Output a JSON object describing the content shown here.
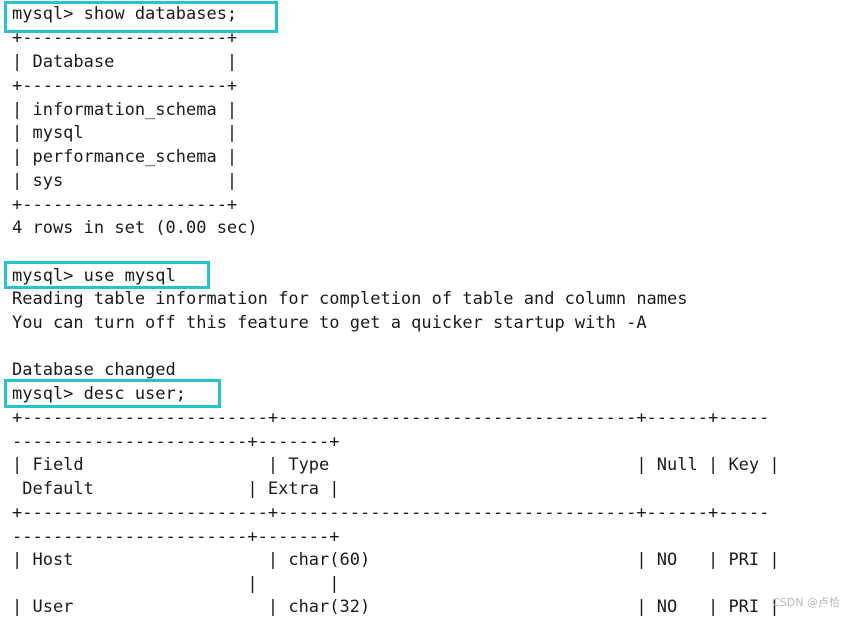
{
  "terminal": {
    "lines": [
      "mysql> show databases;",
      "+--------------------+",
      "| Database           |",
      "+--------------------+",
      "| information_schema |",
      "| mysql              |",
      "| performance_schema |",
      "| sys                |",
      "+--------------------+",
      "4 rows in set (0.00 sec)",
      "",
      "mysql> use mysql",
      "Reading table information for completion of table and column names",
      "You can turn off this feature to get a quicker startup with -A",
      "",
      "Database changed",
      "mysql> desc user;",
      "+------------------------+-----------------------------------+------+-----",
      "-----------------------+-------+",
      "| Field                  | Type                              | Null | Key |",
      " Default               | Extra |",
      "+------------------------+-----------------------------------+------+-----",
      "-----------------------+-------+",
      "| Host                   | char(60)                          | NO   | PRI |",
      "                       |       |",
      "| User                   | char(32)                          | NO   | PRI |"
    ]
  },
  "highlight_color": "#27c3cc",
  "watermark": "CSDN @卢恰"
}
